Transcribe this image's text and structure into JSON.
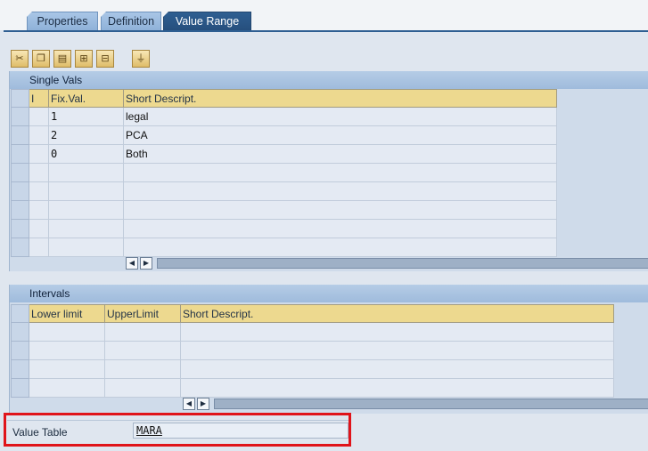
{
  "tabs": [
    {
      "label": "Properties",
      "active": false
    },
    {
      "label": "Definition",
      "active": false
    },
    {
      "label": "Value Range",
      "active": true
    }
  ],
  "toolbar": {
    "buttons": [
      "cut-icon",
      "copy-icon",
      "paste-icon",
      "insert-row-icon",
      "delete-row-icon",
      "filter-icon"
    ]
  },
  "single_vals": {
    "title": "Single Vals",
    "columns": [
      "I",
      "Fix.Val.",
      "Short Descript."
    ],
    "rows": [
      {
        "fix_val": "1",
        "descr": "legal"
      },
      {
        "fix_val": "2",
        "descr": "PCA"
      },
      {
        "fix_val": "0",
        "descr": "Both"
      },
      {
        "fix_val": "",
        "descr": ""
      },
      {
        "fix_val": "",
        "descr": ""
      },
      {
        "fix_val": "",
        "descr": ""
      },
      {
        "fix_val": "",
        "descr": ""
      },
      {
        "fix_val": "",
        "descr": ""
      }
    ]
  },
  "intervals": {
    "title": "Intervals",
    "columns": [
      "Lower limit",
      "UpperLimit",
      "Short Descript."
    ],
    "rows": [
      {
        "lower": "",
        "upper": "",
        "descr": ""
      },
      {
        "lower": "",
        "upper": "",
        "descr": ""
      },
      {
        "lower": "",
        "upper": "",
        "descr": ""
      },
      {
        "lower": "",
        "upper": "",
        "descr": ""
      }
    ]
  },
  "value_table": {
    "label": "Value Table",
    "value": "MARA"
  },
  "colors": {
    "tab_active": "#2f5f92",
    "header_yellow": "#edd98f",
    "highlight": "#e0141a"
  }
}
